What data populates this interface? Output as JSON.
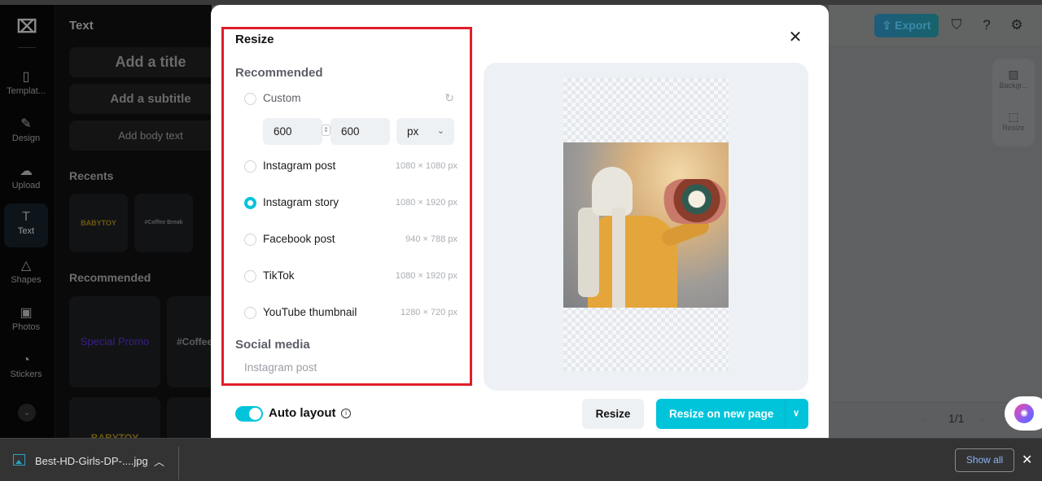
{
  "rail": {
    "logo": "capcut-logo",
    "items": [
      {
        "label": "Templat...",
        "icon": "template-icon"
      },
      {
        "label": "Design",
        "icon": "design-icon"
      },
      {
        "label": "Upload",
        "icon": "upload-cloud-icon"
      },
      {
        "label": "Text",
        "icon": "text-icon"
      },
      {
        "label": "Shapes",
        "icon": "shapes-icon"
      },
      {
        "label": "Photos",
        "icon": "photos-icon"
      },
      {
        "label": "Stickers",
        "icon": "stickers-icon"
      }
    ],
    "active": "Text"
  },
  "text_panel": {
    "title": "Text",
    "buttons": [
      "Add a title",
      "Add a subtitle",
      "Add body text"
    ],
    "recents_label": "Recents",
    "recents": [
      "BABYTOY",
      "#Coffee Break"
    ],
    "recommended_label": "Recommended",
    "recommended": [
      "Special Promo",
      "#Coffee",
      "BABYTOY",
      ""
    ]
  },
  "topbar": {
    "export_label": "Export",
    "icons": [
      "shield-check-icon",
      "help-icon",
      "settings-icon"
    ]
  },
  "side_tools": [
    {
      "label": "Backgr...",
      "icon": "background-icon"
    },
    {
      "label": "Resize",
      "icon": "resize-icon"
    }
  ],
  "pager": {
    "text": "1/1"
  },
  "modal": {
    "title": "Resize",
    "recommended_label": "Recommended",
    "options": [
      {
        "label": "Custom",
        "dims": "",
        "selected": false
      },
      {
        "label": "Instagram post",
        "dims": "1080 × 1080 px",
        "selected": false
      },
      {
        "label": "Instagram story",
        "dims": "1080 × 1920 px",
        "selected": true
      },
      {
        "label": "Facebook post",
        "dims": "940 × 788 px",
        "selected": false
      },
      {
        "label": "TikTok",
        "dims": "1080 × 1920 px",
        "selected": false
      },
      {
        "label": "YouTube thumbnail",
        "dims": "1280 × 720 px",
        "selected": false
      }
    ],
    "custom": {
      "width": "600",
      "height": "600",
      "unit": "px"
    },
    "social_media_label": "Social media",
    "social_items": [
      "Instagram post"
    ],
    "auto_layout_label": "Auto layout",
    "auto_layout_on": true,
    "resize_label": "Resize",
    "resize_new_label": "Resize on new page",
    "accent": "#00c4da"
  },
  "download_bar": {
    "file_name": "Best-HD-Girls-DP-....jpg",
    "show_all_label": "Show all"
  }
}
